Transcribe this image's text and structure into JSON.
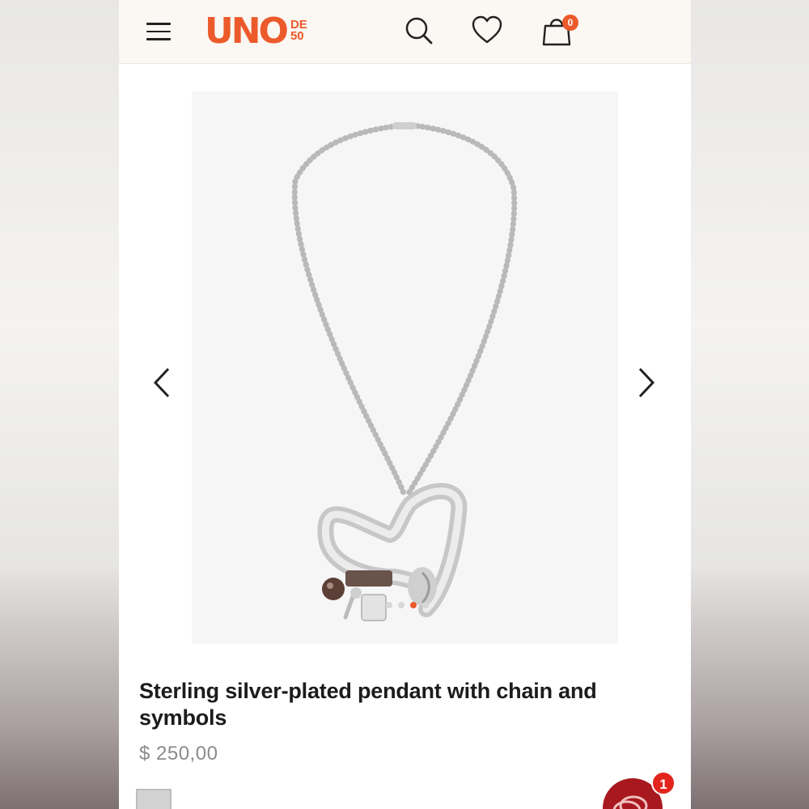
{
  "header": {
    "logo_main": "UNO",
    "logo_de": "DE",
    "logo_50": "50",
    "cart_count": "0",
    "icons": [
      "menu-icon",
      "search-icon",
      "heart-icon",
      "shopping-bag-icon"
    ]
  },
  "carousel": {
    "image_alt": "Silver heart pendant necklace with ball chain and charms",
    "slides": 4,
    "active_slide": 3
  },
  "product": {
    "title": "Sterling silver-plated pendant with chain and symbols",
    "price": "$ 250,00",
    "selected_color": "silver"
  },
  "chat": {
    "badge": "1"
  },
  "colors": {
    "brand": "#ec5a2b",
    "header_bg": "#fbf7f2",
    "chat": "#a8191f"
  }
}
